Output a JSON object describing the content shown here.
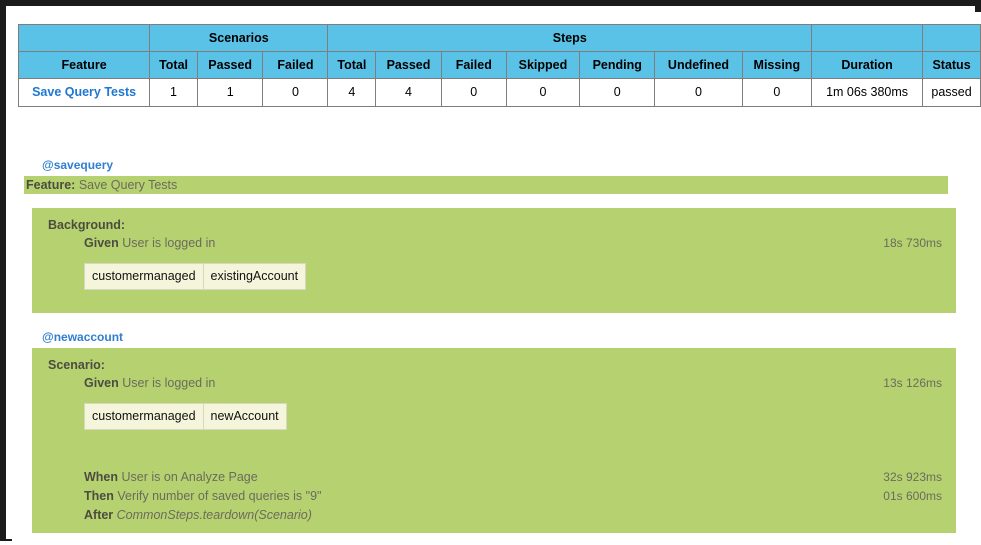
{
  "summary_table": {
    "group_headers": [
      {
        "label": "",
        "span": 1
      },
      {
        "label": "Scenarios",
        "span": 3
      },
      {
        "label": "Steps",
        "span": 7
      },
      {
        "label": "",
        "span": 1
      },
      {
        "label": "",
        "span": 1
      }
    ],
    "columns": [
      "Feature",
      "Total",
      "Passed",
      "Failed",
      "Total",
      "Passed",
      "Failed",
      "Skipped",
      "Pending",
      "Undefined",
      "Missing",
      "Duration",
      "Status"
    ],
    "rows": [
      {
        "feature": "Save Query Tests",
        "scenarios_total": "1",
        "scenarios_passed": "1",
        "scenarios_failed": "0",
        "steps_total": "4",
        "steps_passed": "4",
        "steps_failed": "0",
        "steps_skipped": "0",
        "steps_pending": "0",
        "steps_undefined": "0",
        "steps_missing": "0",
        "duration": "1m 06s 380ms",
        "status": "passed"
      }
    ]
  },
  "report": {
    "feature_tag": "@savequery",
    "feature_keyword": "Feature:",
    "feature_name": "Save Query Tests",
    "background": {
      "title": "Background:",
      "steps": [
        {
          "keyword": "Given",
          "text": "User is logged in",
          "duration": "18s 730ms"
        }
      ],
      "data_table": {
        "rows": [
          [
            "customermanaged",
            "existingAccount"
          ]
        ]
      }
    },
    "scenario": {
      "tag": "@newaccount",
      "title": "Scenario:",
      "first_step": {
        "keyword": "Given",
        "text": "User is logged in",
        "duration": "13s 126ms"
      },
      "data_table": {
        "rows": [
          [
            "customermanaged",
            "newAccount"
          ]
        ]
      },
      "steps": [
        {
          "keyword": "When",
          "text": "User is on Analyze Page",
          "duration": "32s 923ms",
          "hook": false
        },
        {
          "keyword": "Then",
          "text": "Verify number of saved queries is \"9\"",
          "duration": "01s 600ms",
          "hook": false
        },
        {
          "keyword": "After",
          "text": "CommonSteps.teardown(Scenario)",
          "duration": "",
          "hook": true
        }
      ]
    }
  },
  "colors": {
    "header_blue": "#5bc2e7",
    "passed_green": "#b6d270",
    "link_blue": "#1f77d0",
    "tag_blue": "#2f7fd1",
    "data_table_cream": "#f5f5dc"
  }
}
